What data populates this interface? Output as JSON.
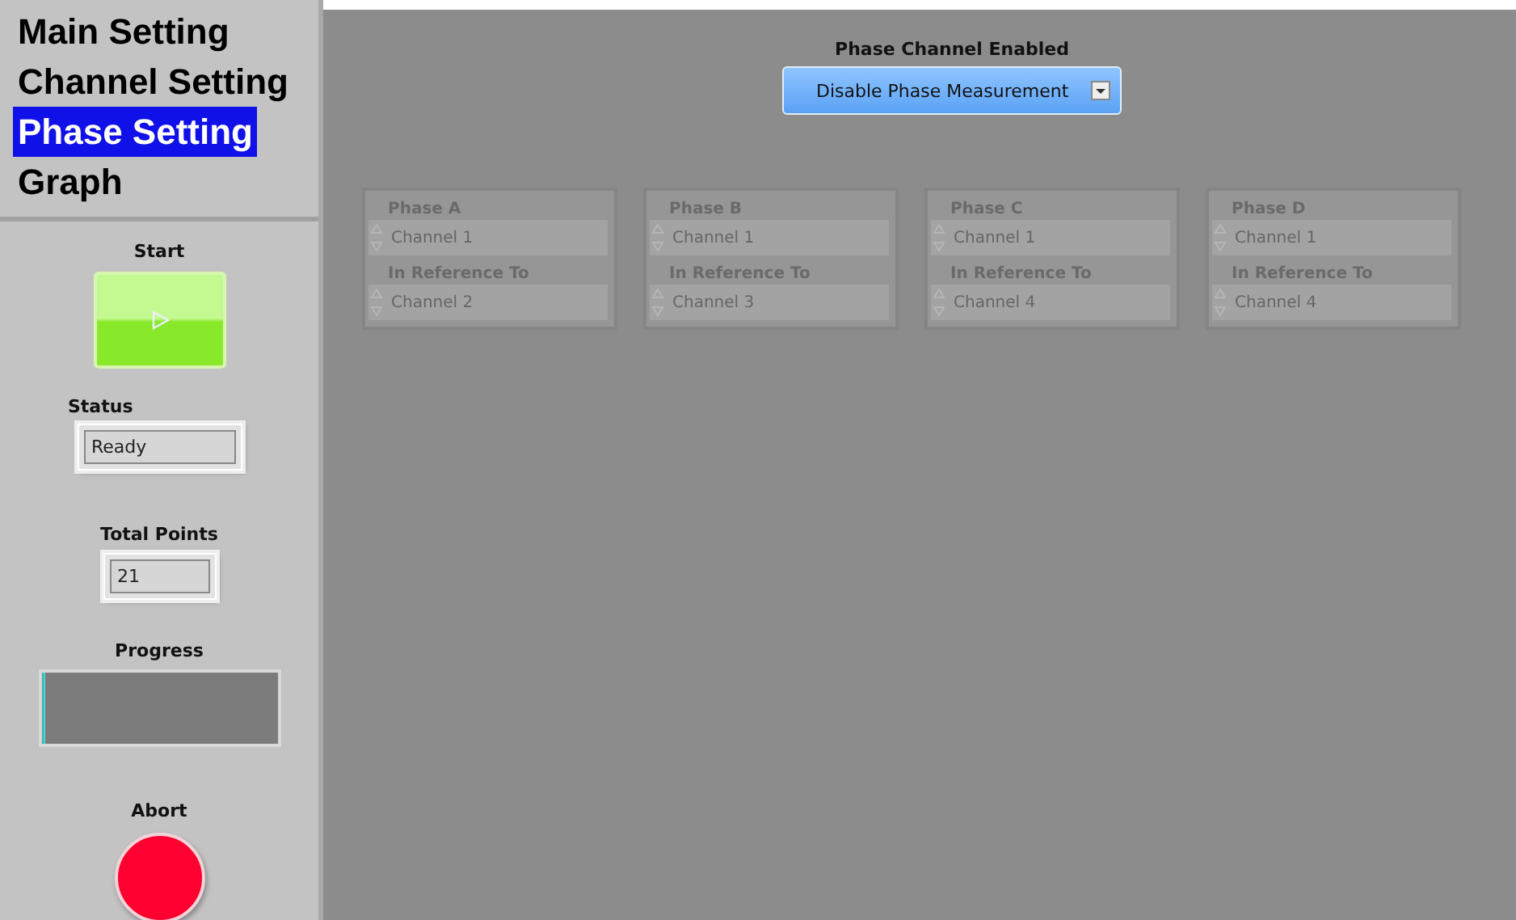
{
  "tabs": [
    {
      "label": "Main Setting",
      "selected": false
    },
    {
      "label": "Channel Setting",
      "selected": false
    },
    {
      "label": "Phase Setting",
      "selected": true
    },
    {
      "label": "Graph",
      "selected": false
    }
  ],
  "controls": {
    "start": {
      "label": "Start"
    },
    "status": {
      "label": "Status",
      "value": "Ready"
    },
    "total_points": {
      "label": "Total Points",
      "value": "21"
    },
    "progress": {
      "label": "Progress",
      "level": 0.02
    },
    "abort": {
      "label": "Abort"
    }
  },
  "phase_channel": {
    "label": "Phase Channel Enabled",
    "value": "Disable Phase Measurement"
  },
  "phases": [
    {
      "label": "Phase A",
      "channel": "Channel 1",
      "reference_label": "In Reference To",
      "reference": "Channel 2",
      "disabled": true
    },
    {
      "label": "Phase B",
      "channel": "Channel 1",
      "reference_label": "In Reference To",
      "reference": "Channel 3",
      "disabled": true
    },
    {
      "label": "Phase C",
      "channel": "Channel 1",
      "reference_label": "In Reference To",
      "reference": "Channel 4",
      "disabled": true
    },
    {
      "label": "Phase D",
      "channel": "Channel 1",
      "reference_label": "In Reference To",
      "reference": "Channel 4",
      "disabled": true
    }
  ]
}
